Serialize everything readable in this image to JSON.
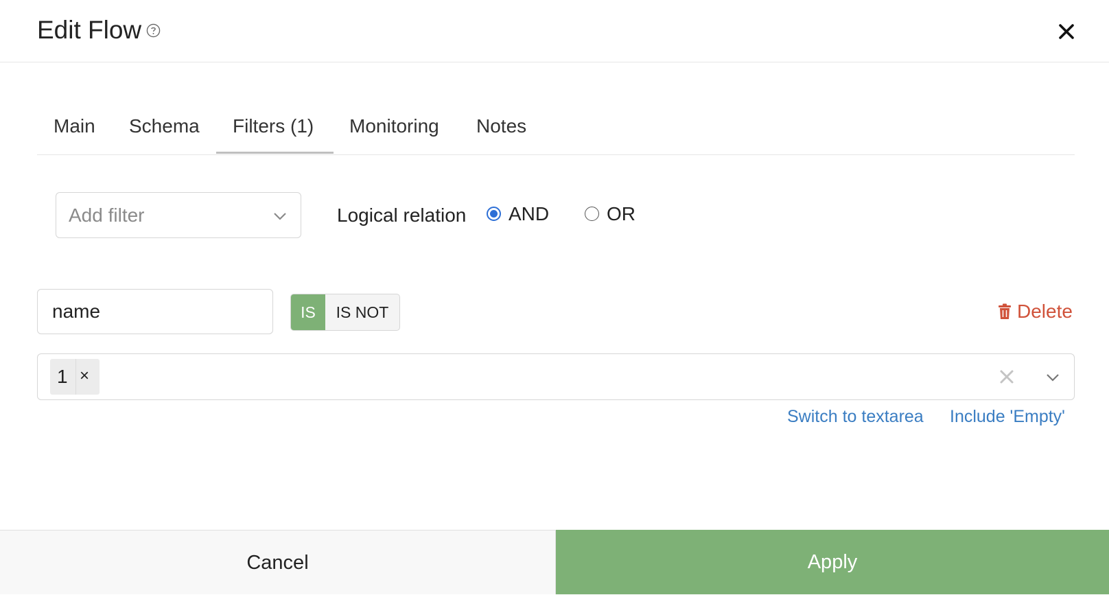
{
  "header": {
    "title": "Edit Flow",
    "help_icon": "question-circle-icon",
    "close_icon": "close-icon"
  },
  "tabs": [
    {
      "label": "Main"
    },
    {
      "label": "Schema"
    },
    {
      "label": "Filters (1)",
      "active": true
    },
    {
      "label": "Monitoring"
    },
    {
      "label": "Notes"
    }
  ],
  "filters": {
    "add_filter_placeholder": "Add filter",
    "logical_relation_label": "Logical relation",
    "options": [
      {
        "label": "AND",
        "selected": true
      },
      {
        "label": "OR",
        "selected": false
      }
    ]
  },
  "filter_row": {
    "field_value": "name",
    "toggle": {
      "is_label": "IS",
      "is_not_label": "IS NOT",
      "selected": "IS"
    },
    "delete_label": "Delete",
    "values": [
      "1"
    ],
    "tag_remove_label": "×",
    "links": {
      "switch_textarea": "Switch to textarea",
      "include_empty": "Include 'Empty'"
    }
  },
  "footer": {
    "cancel_label": "Cancel",
    "apply_label": "Apply"
  },
  "colors": {
    "accent_green": "#7eb176",
    "delete_red": "#d0523a",
    "link_blue": "#3a7dc2",
    "radio_blue": "#2d6fd6"
  }
}
